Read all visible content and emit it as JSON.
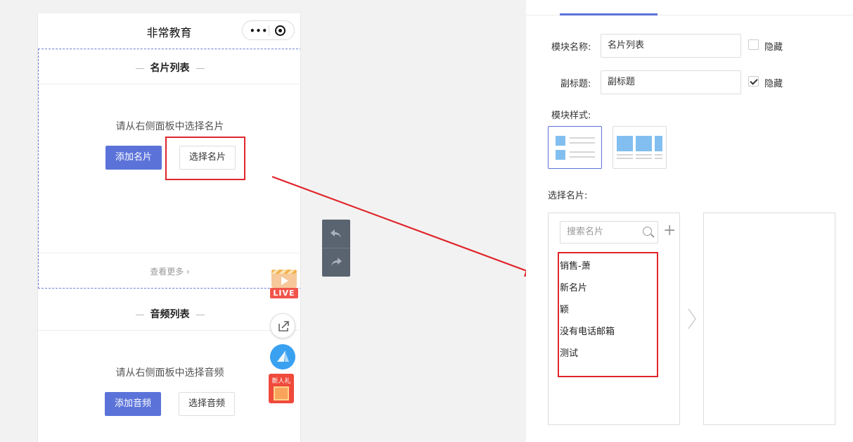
{
  "phone": {
    "title": "非常教育",
    "capsule_dots": "•••"
  },
  "card_module": {
    "title": "名片列表",
    "hint": "请从右侧面板中选择名片",
    "add_button": "添加名片",
    "select_button": "选择名片",
    "see_more": "查看更多 ›"
  },
  "audio_module": {
    "title": "音频列表",
    "hint": "请从右侧面板中选择音频",
    "add_button": "添加音频",
    "select_button": "选择音频"
  },
  "floating": {
    "live_label": "LIVE",
    "gift_label": "新人礼"
  },
  "panel": {
    "module_name_label": "模块名称:",
    "module_name_value": "名片列表",
    "hide_label_1": "隐藏",
    "subtitle_label": "副标题:",
    "subtitle_value": "副标题",
    "hide_label_2": "隐藏",
    "style_label": "模块样式:",
    "select_cards_label": "选择名片:",
    "search_placeholder": "搜索名片",
    "plus": "+",
    "cards": [
      "销售-萧",
      "新名片",
      "颖",
      "没有电话邮箱",
      "测试"
    ]
  },
  "colors": {
    "primary": "#5b73d9",
    "highlight": "#e0262b",
    "preview_blue": "#82bff0"
  }
}
